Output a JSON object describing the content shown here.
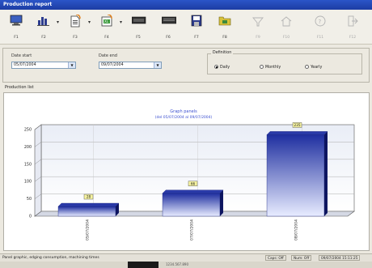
{
  "window": {
    "title": "Production report"
  },
  "toolbar": {
    "buttons": [
      {
        "key": "F1",
        "icon": "monitor-icon",
        "enabled": true
      },
      {
        "key": "F2",
        "icon": "bar-chart-icon",
        "enabled": true
      },
      {
        "key": "F3",
        "icon": "document-export-icon",
        "enabled": true
      },
      {
        "key": "F4",
        "icon": "excel-export-icon",
        "enabled": true
      },
      {
        "key": "F5",
        "icon": "panel-icon",
        "enabled": true
      },
      {
        "key": "F6",
        "icon": "keyboard-icon",
        "enabled": true
      },
      {
        "key": "F7",
        "icon": "save-icon",
        "enabled": true
      },
      {
        "key": "F8",
        "icon": "folder-icon",
        "enabled": true
      },
      {
        "key": "F9",
        "icon": "filter-icon",
        "enabled": false
      },
      {
        "key": "F10",
        "icon": "home-icon",
        "enabled": false
      },
      {
        "key": "F11",
        "icon": "help-icon",
        "enabled": false
      },
      {
        "key": "F12",
        "icon": "exit-icon",
        "enabled": false
      }
    ]
  },
  "filters": {
    "date_start_label": "Date start",
    "date_start_value": "05/07/2004",
    "date_end_label": "Date end",
    "date_end_value": "09/07/2004",
    "definition_label": "Definition",
    "options": [
      {
        "label": "Daily",
        "selected": true
      },
      {
        "label": "Monthly",
        "selected": false
      },
      {
        "label": "Yearly",
        "selected": false
      }
    ]
  },
  "production_list_label": "Production list",
  "chart_data": {
    "type": "bar",
    "title": "Graph panels",
    "subtitle": "(del 05/07/2004 al 09/07/2004)",
    "categories": [
      "05/07/2004",
      "07/07/2004",
      "08/07/2004"
    ],
    "values": [
      28,
      66,
      235
    ],
    "data_labels": [
      "28",
      "66",
      "235"
    ],
    "ylim": [
      0,
      250
    ],
    "yticks": [
      "0",
      "50",
      "100",
      "150",
      "200",
      "250"
    ],
    "grid": true,
    "bar_color": "#2a3fb0"
  },
  "status": {
    "text": "Panel graphic, edging consumption, machining times",
    "caps": "Caps: Off",
    "num": "Num: Off",
    "datetime": "09/07/2004 15:11:25"
  },
  "taskbar": {
    "item": "1234.567.890"
  }
}
